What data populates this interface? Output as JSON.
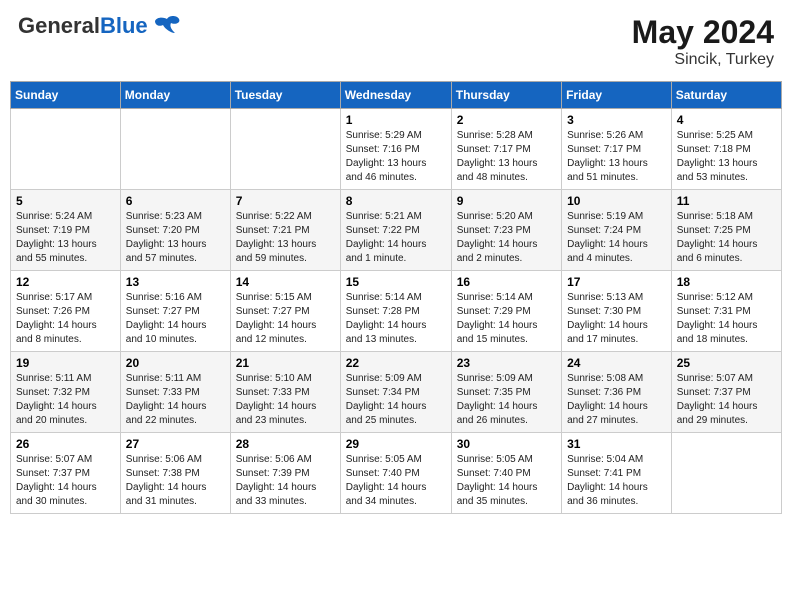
{
  "header": {
    "logo_general": "General",
    "logo_blue": "Blue",
    "month_year": "May 2024",
    "location": "Sincik, Turkey"
  },
  "weekdays": [
    "Sunday",
    "Monday",
    "Tuesday",
    "Wednesday",
    "Thursday",
    "Friday",
    "Saturday"
  ],
  "weeks": [
    [
      {
        "day": "",
        "sunrise": "",
        "sunset": "",
        "daylight": ""
      },
      {
        "day": "",
        "sunrise": "",
        "sunset": "",
        "daylight": ""
      },
      {
        "day": "",
        "sunrise": "",
        "sunset": "",
        "daylight": ""
      },
      {
        "day": "1",
        "sunrise": "Sunrise: 5:29 AM",
        "sunset": "Sunset: 7:16 PM",
        "daylight": "Daylight: 13 hours and 46 minutes."
      },
      {
        "day": "2",
        "sunrise": "Sunrise: 5:28 AM",
        "sunset": "Sunset: 7:17 PM",
        "daylight": "Daylight: 13 hours and 48 minutes."
      },
      {
        "day": "3",
        "sunrise": "Sunrise: 5:26 AM",
        "sunset": "Sunset: 7:17 PM",
        "daylight": "Daylight: 13 hours and 51 minutes."
      },
      {
        "day": "4",
        "sunrise": "Sunrise: 5:25 AM",
        "sunset": "Sunset: 7:18 PM",
        "daylight": "Daylight: 13 hours and 53 minutes."
      }
    ],
    [
      {
        "day": "5",
        "sunrise": "Sunrise: 5:24 AM",
        "sunset": "Sunset: 7:19 PM",
        "daylight": "Daylight: 13 hours and 55 minutes."
      },
      {
        "day": "6",
        "sunrise": "Sunrise: 5:23 AM",
        "sunset": "Sunset: 7:20 PM",
        "daylight": "Daylight: 13 hours and 57 minutes."
      },
      {
        "day": "7",
        "sunrise": "Sunrise: 5:22 AM",
        "sunset": "Sunset: 7:21 PM",
        "daylight": "Daylight: 13 hours and 59 minutes."
      },
      {
        "day": "8",
        "sunrise": "Sunrise: 5:21 AM",
        "sunset": "Sunset: 7:22 PM",
        "daylight": "Daylight: 14 hours and 1 minute."
      },
      {
        "day": "9",
        "sunrise": "Sunrise: 5:20 AM",
        "sunset": "Sunset: 7:23 PM",
        "daylight": "Daylight: 14 hours and 2 minutes."
      },
      {
        "day": "10",
        "sunrise": "Sunrise: 5:19 AM",
        "sunset": "Sunset: 7:24 PM",
        "daylight": "Daylight: 14 hours and 4 minutes."
      },
      {
        "day": "11",
        "sunrise": "Sunrise: 5:18 AM",
        "sunset": "Sunset: 7:25 PM",
        "daylight": "Daylight: 14 hours and 6 minutes."
      }
    ],
    [
      {
        "day": "12",
        "sunrise": "Sunrise: 5:17 AM",
        "sunset": "Sunset: 7:26 PM",
        "daylight": "Daylight: 14 hours and 8 minutes."
      },
      {
        "day": "13",
        "sunrise": "Sunrise: 5:16 AM",
        "sunset": "Sunset: 7:27 PM",
        "daylight": "Daylight: 14 hours and 10 minutes."
      },
      {
        "day": "14",
        "sunrise": "Sunrise: 5:15 AM",
        "sunset": "Sunset: 7:27 PM",
        "daylight": "Daylight: 14 hours and 12 minutes."
      },
      {
        "day": "15",
        "sunrise": "Sunrise: 5:14 AM",
        "sunset": "Sunset: 7:28 PM",
        "daylight": "Daylight: 14 hours and 13 minutes."
      },
      {
        "day": "16",
        "sunrise": "Sunrise: 5:14 AM",
        "sunset": "Sunset: 7:29 PM",
        "daylight": "Daylight: 14 hours and 15 minutes."
      },
      {
        "day": "17",
        "sunrise": "Sunrise: 5:13 AM",
        "sunset": "Sunset: 7:30 PM",
        "daylight": "Daylight: 14 hours and 17 minutes."
      },
      {
        "day": "18",
        "sunrise": "Sunrise: 5:12 AM",
        "sunset": "Sunset: 7:31 PM",
        "daylight": "Daylight: 14 hours and 18 minutes."
      }
    ],
    [
      {
        "day": "19",
        "sunrise": "Sunrise: 5:11 AM",
        "sunset": "Sunset: 7:32 PM",
        "daylight": "Daylight: 14 hours and 20 minutes."
      },
      {
        "day": "20",
        "sunrise": "Sunrise: 5:11 AM",
        "sunset": "Sunset: 7:33 PM",
        "daylight": "Daylight: 14 hours and 22 minutes."
      },
      {
        "day": "21",
        "sunrise": "Sunrise: 5:10 AM",
        "sunset": "Sunset: 7:33 PM",
        "daylight": "Daylight: 14 hours and 23 minutes."
      },
      {
        "day": "22",
        "sunrise": "Sunrise: 5:09 AM",
        "sunset": "Sunset: 7:34 PM",
        "daylight": "Daylight: 14 hours and 25 minutes."
      },
      {
        "day": "23",
        "sunrise": "Sunrise: 5:09 AM",
        "sunset": "Sunset: 7:35 PM",
        "daylight": "Daylight: 14 hours and 26 minutes."
      },
      {
        "day": "24",
        "sunrise": "Sunrise: 5:08 AM",
        "sunset": "Sunset: 7:36 PM",
        "daylight": "Daylight: 14 hours and 27 minutes."
      },
      {
        "day": "25",
        "sunrise": "Sunrise: 5:07 AM",
        "sunset": "Sunset: 7:37 PM",
        "daylight": "Daylight: 14 hours and 29 minutes."
      }
    ],
    [
      {
        "day": "26",
        "sunrise": "Sunrise: 5:07 AM",
        "sunset": "Sunset: 7:37 PM",
        "daylight": "Daylight: 14 hours and 30 minutes."
      },
      {
        "day": "27",
        "sunrise": "Sunrise: 5:06 AM",
        "sunset": "Sunset: 7:38 PM",
        "daylight": "Daylight: 14 hours and 31 minutes."
      },
      {
        "day": "28",
        "sunrise": "Sunrise: 5:06 AM",
        "sunset": "Sunset: 7:39 PM",
        "daylight": "Daylight: 14 hours and 33 minutes."
      },
      {
        "day": "29",
        "sunrise": "Sunrise: 5:05 AM",
        "sunset": "Sunset: 7:40 PM",
        "daylight": "Daylight: 14 hours and 34 minutes."
      },
      {
        "day": "30",
        "sunrise": "Sunrise: 5:05 AM",
        "sunset": "Sunset: 7:40 PM",
        "daylight": "Daylight: 14 hours and 35 minutes."
      },
      {
        "day": "31",
        "sunrise": "Sunrise: 5:04 AM",
        "sunset": "Sunset: 7:41 PM",
        "daylight": "Daylight: 14 hours and 36 minutes."
      },
      {
        "day": "",
        "sunrise": "",
        "sunset": "",
        "daylight": ""
      }
    ]
  ]
}
